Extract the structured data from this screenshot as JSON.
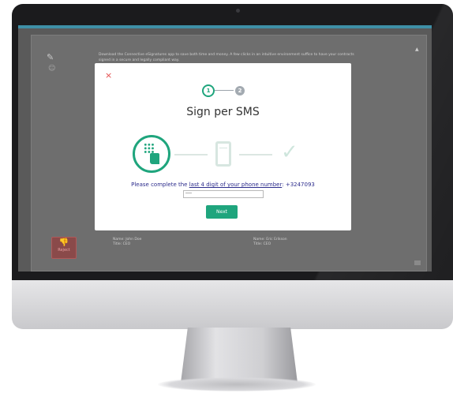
{
  "background_text": "Download the Connective eSignatures app to save both time and money. A few clicks in an intuitive environment suffice to have your contracts signed in a secure and legally compliant way.",
  "reject_label": "Reject",
  "signers": [
    {
      "name": "Name: John Doe",
      "title": "Title: CEO"
    },
    {
      "name": "Name: Eric Erikson",
      "title": "Title: CEO"
    }
  ],
  "modal": {
    "close_symbol": "×",
    "steps": [
      "1",
      "2"
    ],
    "title": "Sign per SMS",
    "instruction_prefix": "Please complete the ",
    "instruction_link": "last 4 digit of your phone number",
    "instruction_suffix": ": +3247093",
    "input_placeholder": "****",
    "next_label": "Next"
  },
  "colors": {
    "accent": "#1fa57d",
    "close": "#e34b4b",
    "reject": "#e06060"
  },
  "icons": [
    "pen-icon",
    "phone-keypad-icon",
    "sms-phone-icon",
    "check-icon",
    "thumbs-down-icon"
  ]
}
